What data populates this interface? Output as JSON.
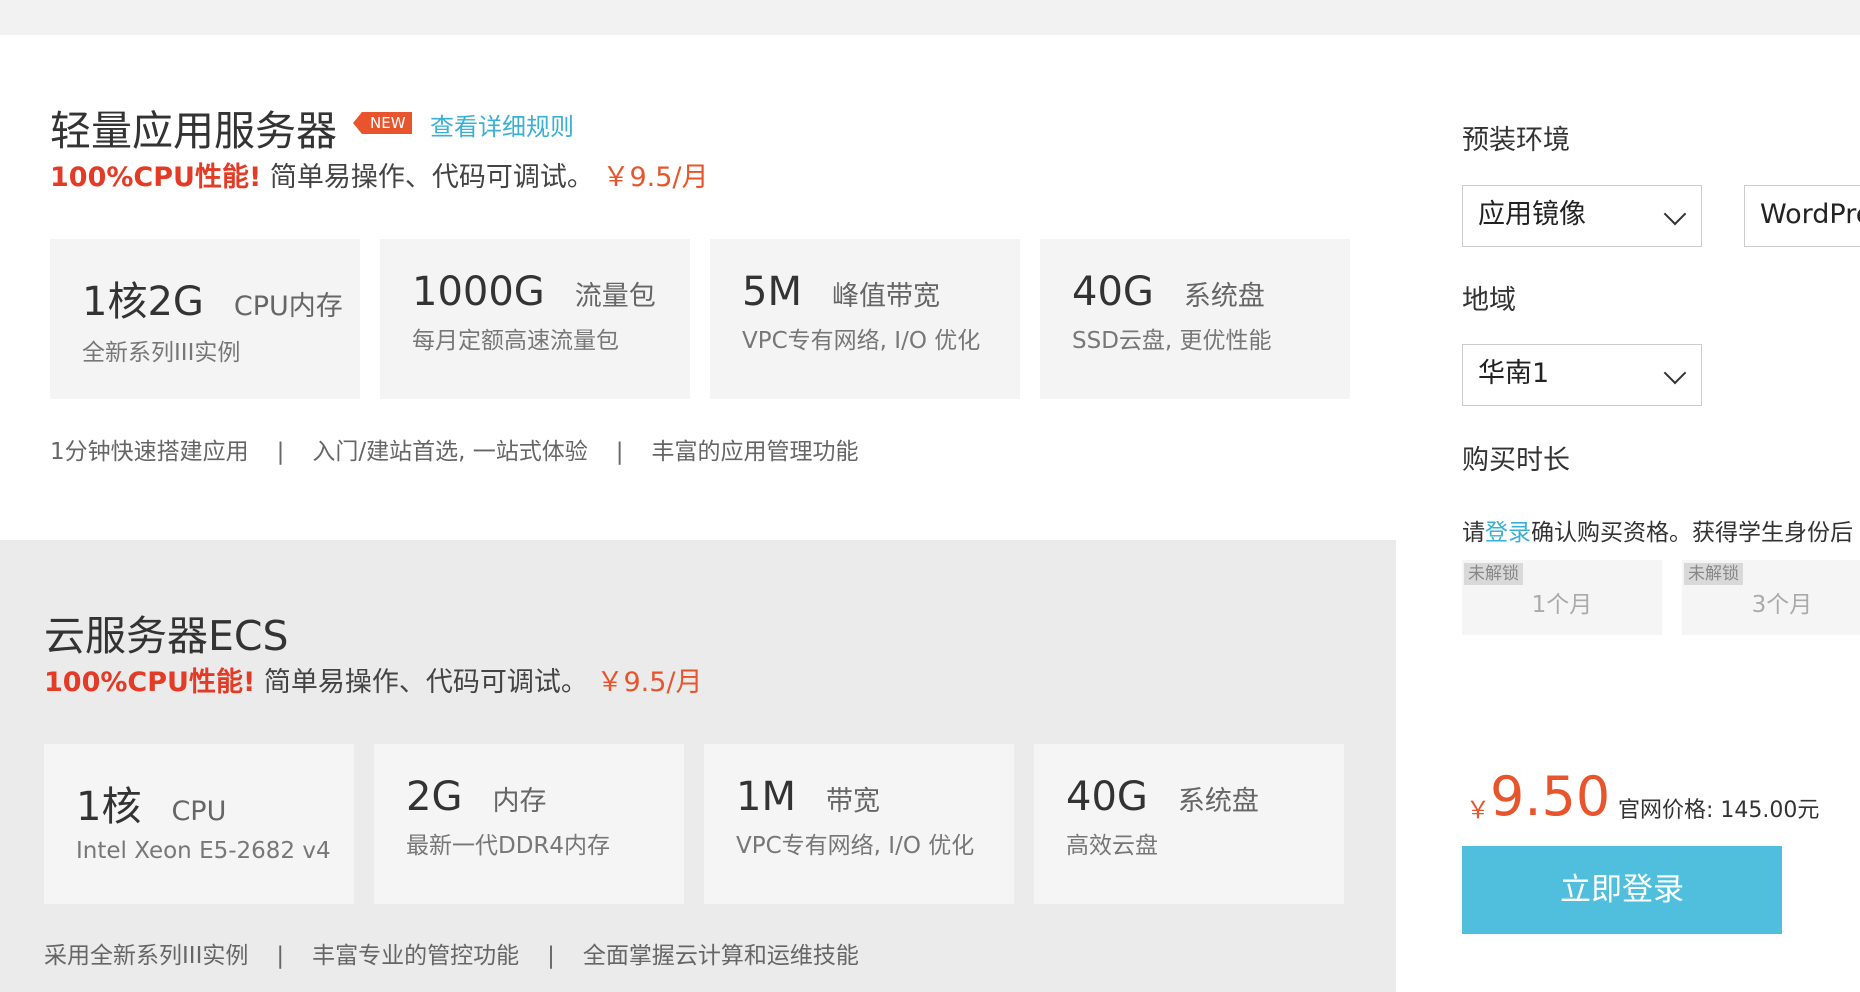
{
  "lite": {
    "title": "轻量应用服务器",
    "badge": "NEW",
    "rules_link": "查看详细规则",
    "promo_hot": "100%CPU性能!",
    "promo_desc": "简单易操作、代码可调试。",
    "promo_price": "￥9.5/月",
    "specs": [
      {
        "big": "1核2G",
        "unit": "CPU内存",
        "sub": "全新系列III实例"
      },
      {
        "big": "1000G",
        "unit": "流量包",
        "sub": "每月定额高速流量包"
      },
      {
        "big": "5M",
        "unit": "峰值带宽",
        "sub": "VPC专有网络, I/O 优化"
      },
      {
        "big": "40G",
        "unit": "系统盘",
        "sub": "SSD云盘, 更优性能"
      }
    ],
    "features": [
      "1分钟快速搭建应用",
      "入门/建站首选, 一站式体验",
      "丰富的应用管理功能"
    ]
  },
  "ecs": {
    "title": "云服务器ECS",
    "promo_hot": "100%CPU性能!",
    "promo_desc": "简单易操作、代码可调试。",
    "promo_price": "￥9.5/月",
    "specs": [
      {
        "big": "1核",
        "unit": "CPU",
        "sub": "Intel Xeon E5-2682 v4"
      },
      {
        "big": "2G",
        "unit": "内存",
        "sub": "最新一代DDR4内存"
      },
      {
        "big": "1M",
        "unit": "带宽",
        "sub": "VPC专有网络, I/O 优化"
      },
      {
        "big": "40G",
        "unit": "系统盘",
        "sub": "高效云盘"
      }
    ],
    "features": [
      "采用全新系列III实例",
      "丰富专业的管控功能",
      "全面掌握云计算和运维技能"
    ]
  },
  "panel": {
    "preinstall_label": "预装环境",
    "image_type": "应用镜像",
    "image_name": "WordPre",
    "region_label": "地域",
    "region": "华南1",
    "duration_label": "购买时长",
    "login_note_prefix": "请",
    "login_note_link": "登录",
    "login_note_suffix": "确认购买资格。获得学生身份后",
    "durations": [
      {
        "lock": "未解锁",
        "label": "1个月"
      },
      {
        "lock": "未解锁",
        "label": "3个月"
      }
    ],
    "currency": "￥",
    "price": "9.50",
    "official_price": "官网价格: 145.00元",
    "login_button": "立即登录"
  },
  "colors": {
    "accent_red": "#e33b26",
    "price_orange": "#e8552d",
    "link_blue": "#3ab0d4",
    "button_blue": "#50bfdd"
  }
}
